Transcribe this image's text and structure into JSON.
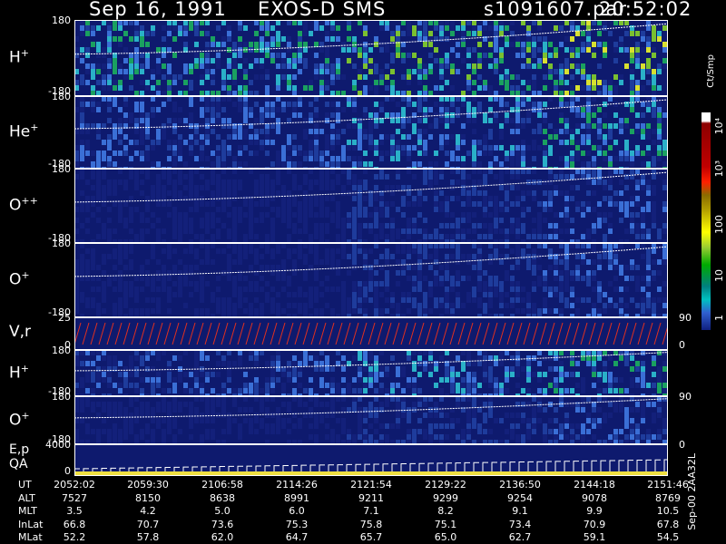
{
  "header": {
    "date": "Sep 16, 1991",
    "instrument": "EXOS-D SMS",
    "file": "s1091607.par",
    "time": "20:52:02"
  },
  "colorbar": {
    "title": "Ct/Smp",
    "labels": [
      "10⁴",
      "10³",
      "100",
      "10",
      "1"
    ]
  },
  "side_stamp": "Sep-00 2AA32L",
  "chart_data": {
    "type": "heatmap",
    "panels": [
      {
        "name": "H",
        "sup": "+",
        "yticks": [
          "180",
          "-180"
        ],
        "intensity": "high"
      },
      {
        "name": "He",
        "sup": "+",
        "yticks": [
          "180",
          "-180"
        ],
        "intensity": "medium"
      },
      {
        "name": "O",
        "sup": "++",
        "yticks": [
          "180",
          "-180"
        ],
        "intensity": "low"
      },
      {
        "name": "O",
        "sup": "+",
        "yticks": [
          "180",
          "-180"
        ],
        "intensity": "low"
      },
      {
        "name": "V,r",
        "sup": "",
        "yticks": [
          "25",
          "0"
        ],
        "right_ticks": [
          "90",
          "0"
        ],
        "intensity": "line"
      },
      {
        "name": "H",
        "sup": "+",
        "yticks": [
          "180",
          "-180"
        ],
        "intensity": "medium"
      },
      {
        "name": "O",
        "sup": "+",
        "yticks": [
          "180",
          "-180"
        ],
        "right_ticks": [
          "90"
        ],
        "intensity": "low"
      },
      {
        "name": "E,p\nQA",
        "sup": "",
        "yticks": [
          "4000",
          "0"
        ],
        "right_ticks": [
          "0"
        ],
        "intensity": "line"
      }
    ],
    "axis_table": {
      "rows": [
        {
          "label": "UT",
          "values": [
            "2052:02",
            "2059:30",
            "2106:58",
            "2114:26",
            "2121:54",
            "2129:22",
            "2136:50",
            "2144:18",
            "2151:46"
          ]
        },
        {
          "label": "ALT",
          "values": [
            "7527",
            "8150",
            "8638",
            "8991",
            "9211",
            "9299",
            "9254",
            "9078",
            "8769"
          ]
        },
        {
          "label": "MLT",
          "values": [
            "3.5",
            "4.2",
            "5.0",
            "6.0",
            "7.1",
            "8.2",
            "9.1",
            "9.9",
            "10.5"
          ]
        },
        {
          "label": "InLat",
          "values": [
            "66.8",
            "70.7",
            "73.6",
            "75.3",
            "75.8",
            "75.1",
            "73.4",
            "70.9",
            "67.8"
          ]
        },
        {
          "label": "MLat",
          "values": [
            "52.2",
            "57.8",
            "62.0",
            "64.7",
            "65.7",
            "65.0",
            "62.7",
            "59.1",
            "54.5"
          ]
        }
      ]
    }
  }
}
